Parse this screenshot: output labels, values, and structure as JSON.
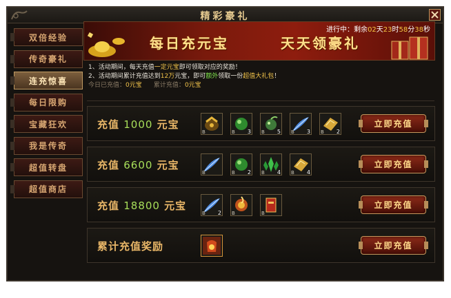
{
  "window": {
    "title": "精彩豪礼",
    "close_icon": "close-icon"
  },
  "sidebar": {
    "items": [
      {
        "label": "双倍经验",
        "active": false
      },
      {
        "label": "传奇豪礼",
        "active": false
      },
      {
        "label": "连充惊喜",
        "active": true
      },
      {
        "label": "每日限购",
        "active": false
      },
      {
        "label": "宝藏狂欢",
        "active": false
      },
      {
        "label": "我是传奇",
        "active": false
      },
      {
        "label": "超值转盘",
        "active": false
      },
      {
        "label": "超值商店",
        "active": false
      }
    ]
  },
  "banner": {
    "left_text": "每日充元宝",
    "right_text": "天天领豪礼",
    "countdown": {
      "prefix": "进行中：剩余",
      "days": "02",
      "d_unit": "天",
      "hours": "23",
      "h_unit": "时",
      "minutes": "58",
      "m_unit": "分",
      "seconds": "38",
      "s_unit": "秒"
    }
  },
  "info": {
    "line1": {
      "a": "1、活动期间，每天充值",
      "b": "一定元宝",
      "c": "即可领取对应的奖励！"
    },
    "line2": {
      "a": "2、活动期间累计充值达到",
      "b": "12万",
      "c": "元宝，即可",
      "d": "额外",
      "e": "领取一份",
      "f": "超值大礼包",
      "g": "！"
    },
    "today": {
      "label": "今日已充值：",
      "value": "0元宝"
    },
    "total": {
      "label": "累计充值：",
      "value": "0元宝"
    }
  },
  "tiers": [
    {
      "prefix": "充值 ",
      "amount": "1000",
      "suffix": " 元宝",
      "button": "立即充值",
      "items": [
        {
          "icon": "gift-pouch-icon",
          "count": ""
        },
        {
          "icon": "green-orb-icon",
          "count": "3"
        },
        {
          "icon": "green-fruit-icon",
          "count": "5"
        },
        {
          "icon": "blue-feather-icon",
          "count": "3"
        },
        {
          "icon": "gold-scroll-icon",
          "count": "2"
        }
      ]
    },
    {
      "prefix": "充值 ",
      "amount": "6600",
      "suffix": " 元宝",
      "button": "立即充值",
      "items": [
        {
          "icon": "blue-feather-icon",
          "count": ""
        },
        {
          "icon": "green-orb-icon",
          "count": "2"
        },
        {
          "icon": "green-crystal-icon",
          "count": "4"
        },
        {
          "icon": "gold-scroll-icon",
          "count": "4"
        }
      ]
    },
    {
      "prefix": "充值 ",
      "amount": "18800",
      "suffix": " 元宝",
      "button": "立即充值",
      "items": [
        {
          "icon": "blue-feather-icon",
          "count": "2"
        },
        {
          "icon": "fire-orb-icon",
          "count": ""
        },
        {
          "icon": "red-book-icon",
          "count": ""
        }
      ]
    },
    {
      "prefix": "累计充值奖励",
      "amount": "",
      "suffix": "",
      "button": "立即充值",
      "items": [
        {
          "icon": "treasure-bag-icon",
          "count": ""
        }
      ]
    }
  ],
  "colors": {
    "accent_gold": "#e9b768",
    "amount_green": "#a8df5a",
    "button_red": "#8b2a18"
  }
}
